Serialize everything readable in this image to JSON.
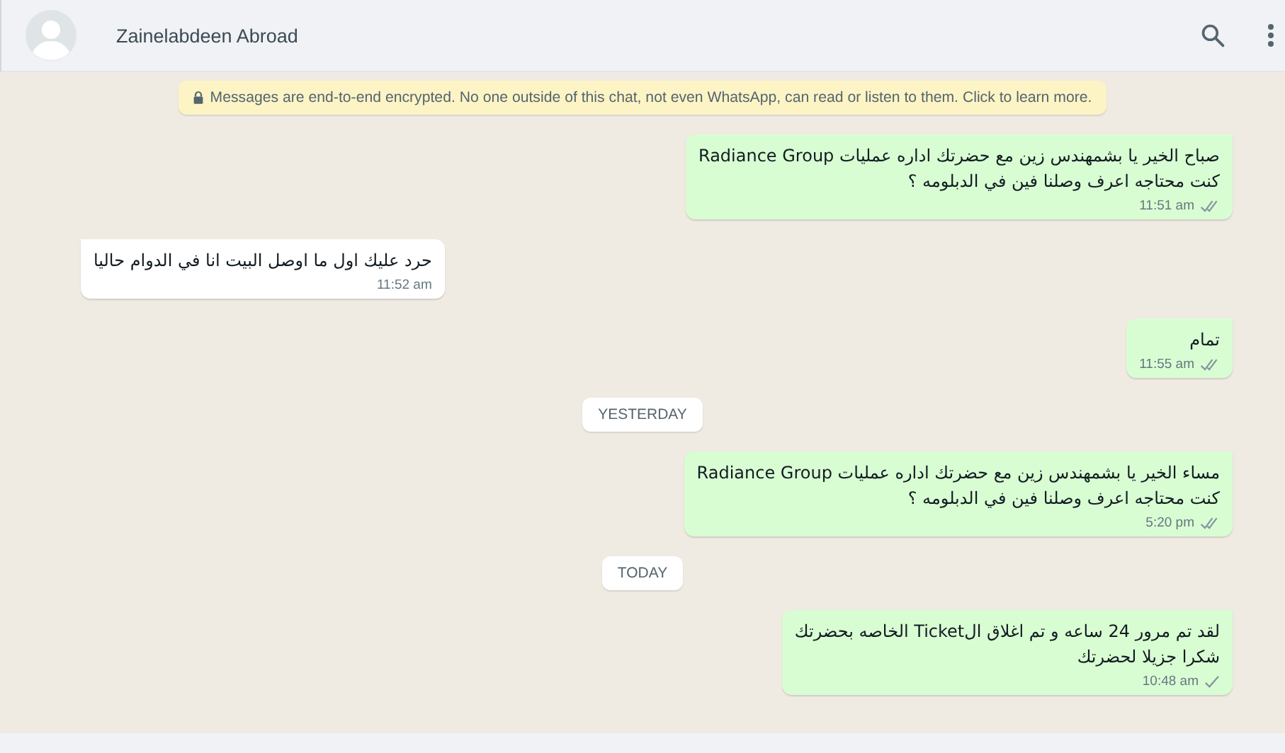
{
  "header": {
    "contact_name": "Zainelabdeen Abroad"
  },
  "encryption_notice": "Messages are end-to-end encrypted. No one outside of this chat, not even WhatsApp, can read or listen to them. Click to learn more.",
  "messages": [
    {
      "kind": "outgoing",
      "text": "صباح الخير يا بشمهندس زين مع حضرتك اداره عمليات Radiance Group\nكنت محتاجه اعرف وصلنا فين في الدبلومه  ؟",
      "time": "11:51 am",
      "double_check": true
    },
    {
      "kind": "incoming",
      "text": "حرد عليك اول ما اوصل البيت انا في الدوام حاليا",
      "time": "11:52 am"
    },
    {
      "kind": "outgoing",
      "text": "تمام",
      "time": "11:55 am",
      "double_check": true
    },
    {
      "kind": "date",
      "text": "YESTERDAY"
    },
    {
      "kind": "outgoing",
      "text": "مساء  الخير يا بشمهندس زين مع حضرتك اداره عمليات Radiance Group\nكنت محتاجه اعرف وصلنا فين في الدبلومه  ؟",
      "time": "5:20 pm",
      "double_check": true
    },
    {
      "kind": "date",
      "text": "TODAY"
    },
    {
      "kind": "outgoing",
      "text": "لقد تم مرور 24 ساعه و تم اغلاق الTicket الخاصه بحضرتك\nشكرا جزيلا لحضرتك",
      "time": "10:48 am",
      "double_check": false
    }
  ]
}
